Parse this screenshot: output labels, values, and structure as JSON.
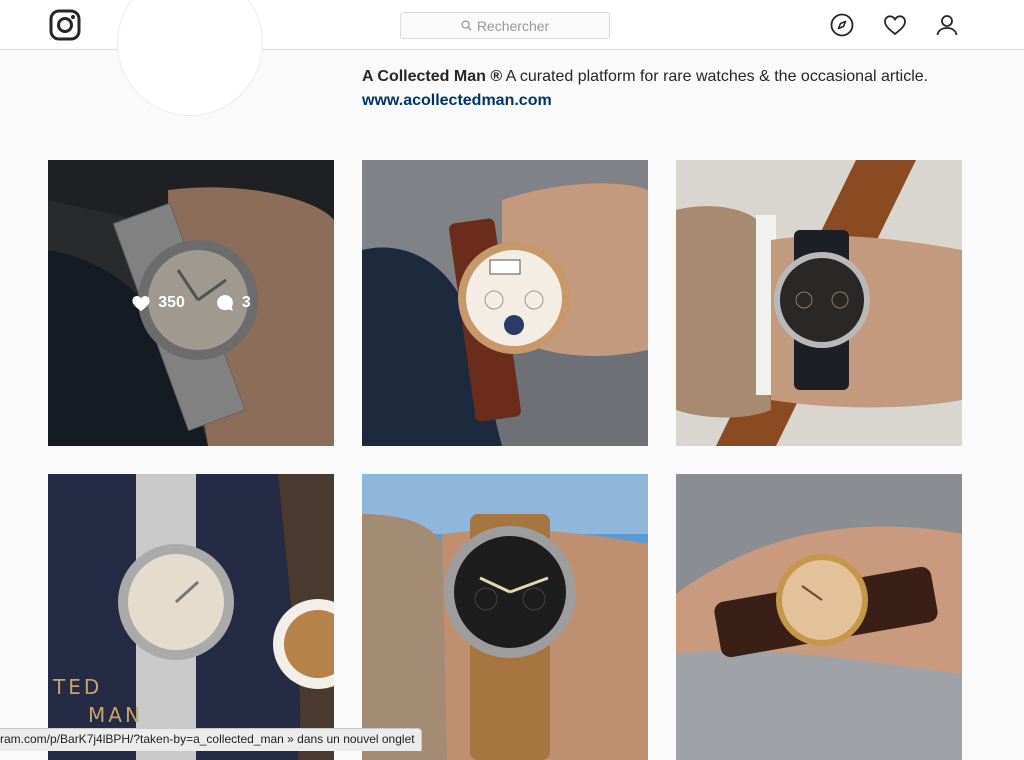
{
  "header": {
    "search_placeholder": "Rechercher"
  },
  "profile": {
    "name": "A Collected Man ®",
    "bio": " A curated platform for rare watches & the occasional article.",
    "website": "www.acollectedman.com"
  },
  "posts": [
    {
      "likes": "350",
      "comments": "3"
    }
  ],
  "status_bar": {
    "text": "ram.com/p/BarK7j4lBPH/?taken-by=a_collected_man » dans un nouvel onglet"
  }
}
